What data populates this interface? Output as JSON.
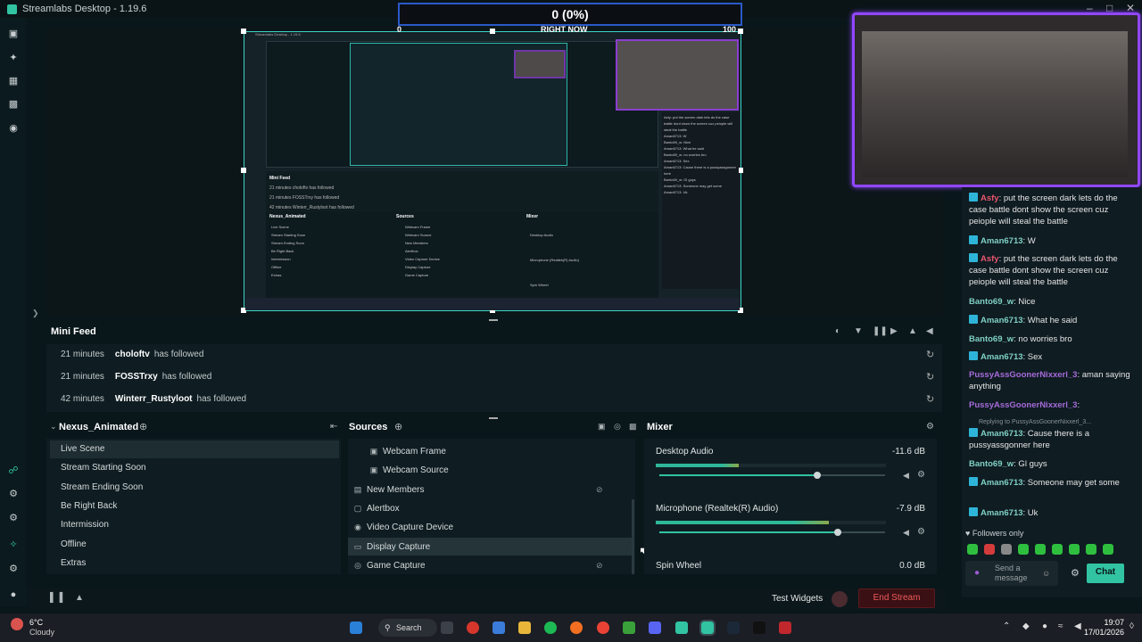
{
  "window": {
    "title": "Streamlabs Desktop - 1.19.6"
  },
  "goal": {
    "center": "0 (0%)",
    "min": "0",
    "label": "RIGHT NOW",
    "max": "100",
    "progress": 0
  },
  "nested": {
    "title": "Streamlabs Desktop - 1.19.6",
    "feed_title": "Mini Feed",
    "feed": [
      "21 minutes  choloftv  has followed",
      "21 minutes  FOSSTrxy  has followed",
      "42 minutes  Winterr_Rustyloot  has followed"
    ],
    "scenes_title": "Nexus_Animated",
    "sources_title": "Sources",
    "mixer_title": "Mixer",
    "scenes": [
      "Live Scene",
      "Stream Starting Soon",
      "Stream Ending Soon",
      "Be Right Back",
      "Intermission",
      "Offline",
      "Extras"
    ],
    "sources": [
      "Webcam Frame",
      "Webcam Source",
      "New Members",
      "Alertbox",
      "Video Capture Device",
      "Display Capture",
      "Game Capture"
    ],
    "mix": [
      "Desktop Audio",
      "Microphone (Realtek(R) Audio)",
      "Spin Wheel"
    ],
    "chat": [
      "Asfy: put the screen dark lets do the case battle dont show the screen cuz peiople will steal the battle",
      "Aman6713: W",
      "Banto69_w: Nice",
      "Aman6713: What he said",
      "Banto69_w: no worries bro",
      "Aman6713: Sex",
      "Aman6713: Cause there is a pussyassgonner here",
      "Banto69_w: Gl guys",
      "Aman6713: Someone may get some",
      "Aman6713: Uk"
    ]
  },
  "chat": {
    "messages": [
      {
        "user": "Asfy",
        "color": "#e7566e",
        "text": ": put the screen dark lets do the case battle dont show the screen cuz peiople will steal the battle",
        "badge": true
      },
      {
        "user": "Aman6713",
        "color": "#7fd0c4",
        "text": ": W",
        "badge": true
      },
      {
        "user": "Asfy",
        "color": "#e7566e",
        "text": ": put the screen dark lets do the case battle dont show the screen cuz peiople will steal the battle",
        "badge": true
      },
      {
        "user": "Banto69_w",
        "color": "#7fd0c4",
        "text": ": Nice",
        "badge": false
      },
      {
        "user": "Aman6713",
        "color": "#7fd0c4",
        "text": ": What he said",
        "badge": true
      },
      {
        "user": "Banto69_w",
        "color": "#7fd0c4",
        "text": ": no worries bro",
        "badge": false
      },
      {
        "user": "Aman6713",
        "color": "#7fd0c4",
        "text": ": Sex",
        "badge": true
      },
      {
        "user": "PussyAssGoonerNixxerl_3",
        "color": "#a66bd9",
        "text": ": aman saying anything",
        "badge": false
      },
      {
        "user": "PussyAssGoonerNixxerl_3",
        "color": "#a66bd9",
        "text": ":",
        "badge": false
      },
      {
        "user": "Aman6713",
        "color": "#7fd0c4",
        "text": ": Cause there is a pussyassgonner here",
        "badge": true
      },
      {
        "user": "Banto69_w",
        "color": "#7fd0c4",
        "text": ": Gl guys",
        "badge": false
      },
      {
        "user": "Aman6713",
        "color": "#7fd0c4",
        "text": ": Someone may get some",
        "badge": true
      },
      {
        "user": "Aman6713",
        "color": "#7fd0c4",
        "text": ": Uk",
        "badge": true
      }
    ],
    "reply_text": "Replying to PussyAssGoonerNixxerl_3...",
    "followers_only": "Followers only",
    "input_placeholder": "Send a message",
    "chat_button": "Chat"
  },
  "minifeed": {
    "title": "Mini Feed",
    "rows": [
      {
        "time": "21 minutes",
        "user": "choloftv",
        "action": "has followed"
      },
      {
        "time": "21 minutes",
        "user": "FOSSTrxy",
        "action": "has followed"
      },
      {
        "time": "42 minutes",
        "user": "Winterr_Rustyloot",
        "action": "has followed"
      }
    ]
  },
  "scenes": {
    "title": "Nexus_Animated",
    "items": [
      "Live Scene",
      "Stream Starting Soon",
      "Stream Ending Soon",
      "Be Right Back",
      "Intermission",
      "Offline",
      "Extras"
    ],
    "active": 0
  },
  "sources": {
    "title": "Sources",
    "items": [
      {
        "label": "Webcam Frame",
        "icon": "image-icon",
        "indent": true,
        "hidden": false,
        "selected": false
      },
      {
        "label": "Webcam Source",
        "icon": "image-icon",
        "indent": true,
        "hidden": false,
        "selected": false
      },
      {
        "label": "New Members",
        "icon": "folder-icon",
        "indent": false,
        "hidden": true,
        "selected": false
      },
      {
        "label": "Alertbox",
        "icon": "bell-icon",
        "indent": false,
        "hidden": false,
        "selected": false
      },
      {
        "label": "Video Capture Device",
        "icon": "camera-icon",
        "indent": false,
        "hidden": false,
        "selected": false
      },
      {
        "label": "Display Capture",
        "icon": "monitor-icon",
        "indent": false,
        "hidden": false,
        "selected": true
      },
      {
        "label": "Game Capture",
        "icon": "gamepad-icon",
        "indent": false,
        "hidden": true,
        "selected": false
      }
    ]
  },
  "mixer": {
    "title": "Mixer",
    "channels": [
      {
        "name": "Desktop Audio",
        "db": "-11.6 dB",
        "level": 0.36,
        "volume": 0.7
      },
      {
        "name": "Microphone (Realtek(R) Audio)",
        "db": "-7.9 dB",
        "level": 0.75,
        "volume": 0.79
      },
      {
        "name": "Spin Wheel",
        "db": "0.0 dB",
        "level": 0,
        "volume": 0
      }
    ]
  },
  "footer": {
    "test_widgets": "Test Widgets",
    "end_stream": "End Stream"
  },
  "taskbar": {
    "weather_temp": "6°C",
    "weather_desc": "Cloudy",
    "search": "Search",
    "time": "19:07",
    "date": "17/01/2026"
  },
  "colors": {
    "accent": "#31c3a2",
    "twitch_purple": "#9147ff",
    "danger": "#f05a5a"
  }
}
